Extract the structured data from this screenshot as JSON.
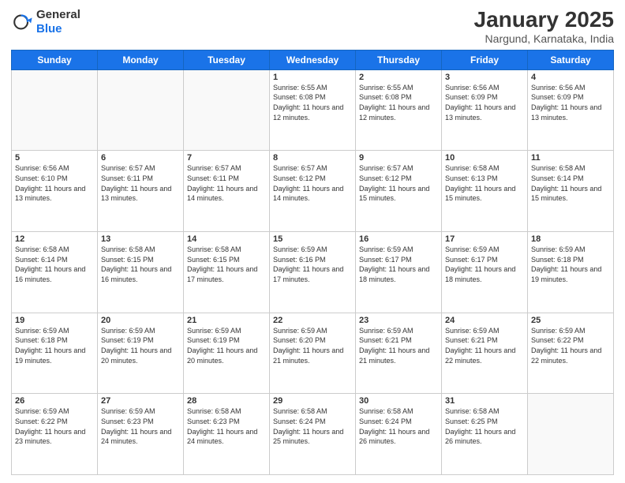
{
  "header": {
    "logo_general": "General",
    "logo_blue": "Blue",
    "title": "January 2025",
    "subtitle": "Nargund, Karnataka, India"
  },
  "days_of_week": [
    "Sunday",
    "Monday",
    "Tuesday",
    "Wednesday",
    "Thursday",
    "Friday",
    "Saturday"
  ],
  "weeks": [
    [
      {
        "day": "",
        "info": ""
      },
      {
        "day": "",
        "info": ""
      },
      {
        "day": "",
        "info": ""
      },
      {
        "day": "1",
        "info": "Sunrise: 6:55 AM\nSunset: 6:08 PM\nDaylight: 11 hours and 12 minutes."
      },
      {
        "day": "2",
        "info": "Sunrise: 6:55 AM\nSunset: 6:08 PM\nDaylight: 11 hours and 12 minutes."
      },
      {
        "day": "3",
        "info": "Sunrise: 6:56 AM\nSunset: 6:09 PM\nDaylight: 11 hours and 13 minutes."
      },
      {
        "day": "4",
        "info": "Sunrise: 6:56 AM\nSunset: 6:09 PM\nDaylight: 11 hours and 13 minutes."
      }
    ],
    [
      {
        "day": "5",
        "info": "Sunrise: 6:56 AM\nSunset: 6:10 PM\nDaylight: 11 hours and 13 minutes."
      },
      {
        "day": "6",
        "info": "Sunrise: 6:57 AM\nSunset: 6:11 PM\nDaylight: 11 hours and 13 minutes."
      },
      {
        "day": "7",
        "info": "Sunrise: 6:57 AM\nSunset: 6:11 PM\nDaylight: 11 hours and 14 minutes."
      },
      {
        "day": "8",
        "info": "Sunrise: 6:57 AM\nSunset: 6:12 PM\nDaylight: 11 hours and 14 minutes."
      },
      {
        "day": "9",
        "info": "Sunrise: 6:57 AM\nSunset: 6:12 PM\nDaylight: 11 hours and 15 minutes."
      },
      {
        "day": "10",
        "info": "Sunrise: 6:58 AM\nSunset: 6:13 PM\nDaylight: 11 hours and 15 minutes."
      },
      {
        "day": "11",
        "info": "Sunrise: 6:58 AM\nSunset: 6:14 PM\nDaylight: 11 hours and 15 minutes."
      }
    ],
    [
      {
        "day": "12",
        "info": "Sunrise: 6:58 AM\nSunset: 6:14 PM\nDaylight: 11 hours and 16 minutes."
      },
      {
        "day": "13",
        "info": "Sunrise: 6:58 AM\nSunset: 6:15 PM\nDaylight: 11 hours and 16 minutes."
      },
      {
        "day": "14",
        "info": "Sunrise: 6:58 AM\nSunset: 6:15 PM\nDaylight: 11 hours and 17 minutes."
      },
      {
        "day": "15",
        "info": "Sunrise: 6:59 AM\nSunset: 6:16 PM\nDaylight: 11 hours and 17 minutes."
      },
      {
        "day": "16",
        "info": "Sunrise: 6:59 AM\nSunset: 6:17 PM\nDaylight: 11 hours and 18 minutes."
      },
      {
        "day": "17",
        "info": "Sunrise: 6:59 AM\nSunset: 6:17 PM\nDaylight: 11 hours and 18 minutes."
      },
      {
        "day": "18",
        "info": "Sunrise: 6:59 AM\nSunset: 6:18 PM\nDaylight: 11 hours and 19 minutes."
      }
    ],
    [
      {
        "day": "19",
        "info": "Sunrise: 6:59 AM\nSunset: 6:18 PM\nDaylight: 11 hours and 19 minutes."
      },
      {
        "day": "20",
        "info": "Sunrise: 6:59 AM\nSunset: 6:19 PM\nDaylight: 11 hours and 20 minutes."
      },
      {
        "day": "21",
        "info": "Sunrise: 6:59 AM\nSunset: 6:19 PM\nDaylight: 11 hours and 20 minutes."
      },
      {
        "day": "22",
        "info": "Sunrise: 6:59 AM\nSunset: 6:20 PM\nDaylight: 11 hours and 21 minutes."
      },
      {
        "day": "23",
        "info": "Sunrise: 6:59 AM\nSunset: 6:21 PM\nDaylight: 11 hours and 21 minutes."
      },
      {
        "day": "24",
        "info": "Sunrise: 6:59 AM\nSunset: 6:21 PM\nDaylight: 11 hours and 22 minutes."
      },
      {
        "day": "25",
        "info": "Sunrise: 6:59 AM\nSunset: 6:22 PM\nDaylight: 11 hours and 22 minutes."
      }
    ],
    [
      {
        "day": "26",
        "info": "Sunrise: 6:59 AM\nSunset: 6:22 PM\nDaylight: 11 hours and 23 minutes."
      },
      {
        "day": "27",
        "info": "Sunrise: 6:59 AM\nSunset: 6:23 PM\nDaylight: 11 hours and 24 minutes."
      },
      {
        "day": "28",
        "info": "Sunrise: 6:58 AM\nSunset: 6:23 PM\nDaylight: 11 hours and 24 minutes."
      },
      {
        "day": "29",
        "info": "Sunrise: 6:58 AM\nSunset: 6:24 PM\nDaylight: 11 hours and 25 minutes."
      },
      {
        "day": "30",
        "info": "Sunrise: 6:58 AM\nSunset: 6:24 PM\nDaylight: 11 hours and 26 minutes."
      },
      {
        "day": "31",
        "info": "Sunrise: 6:58 AM\nSunset: 6:25 PM\nDaylight: 11 hours and 26 minutes."
      },
      {
        "day": "",
        "info": ""
      }
    ]
  ]
}
